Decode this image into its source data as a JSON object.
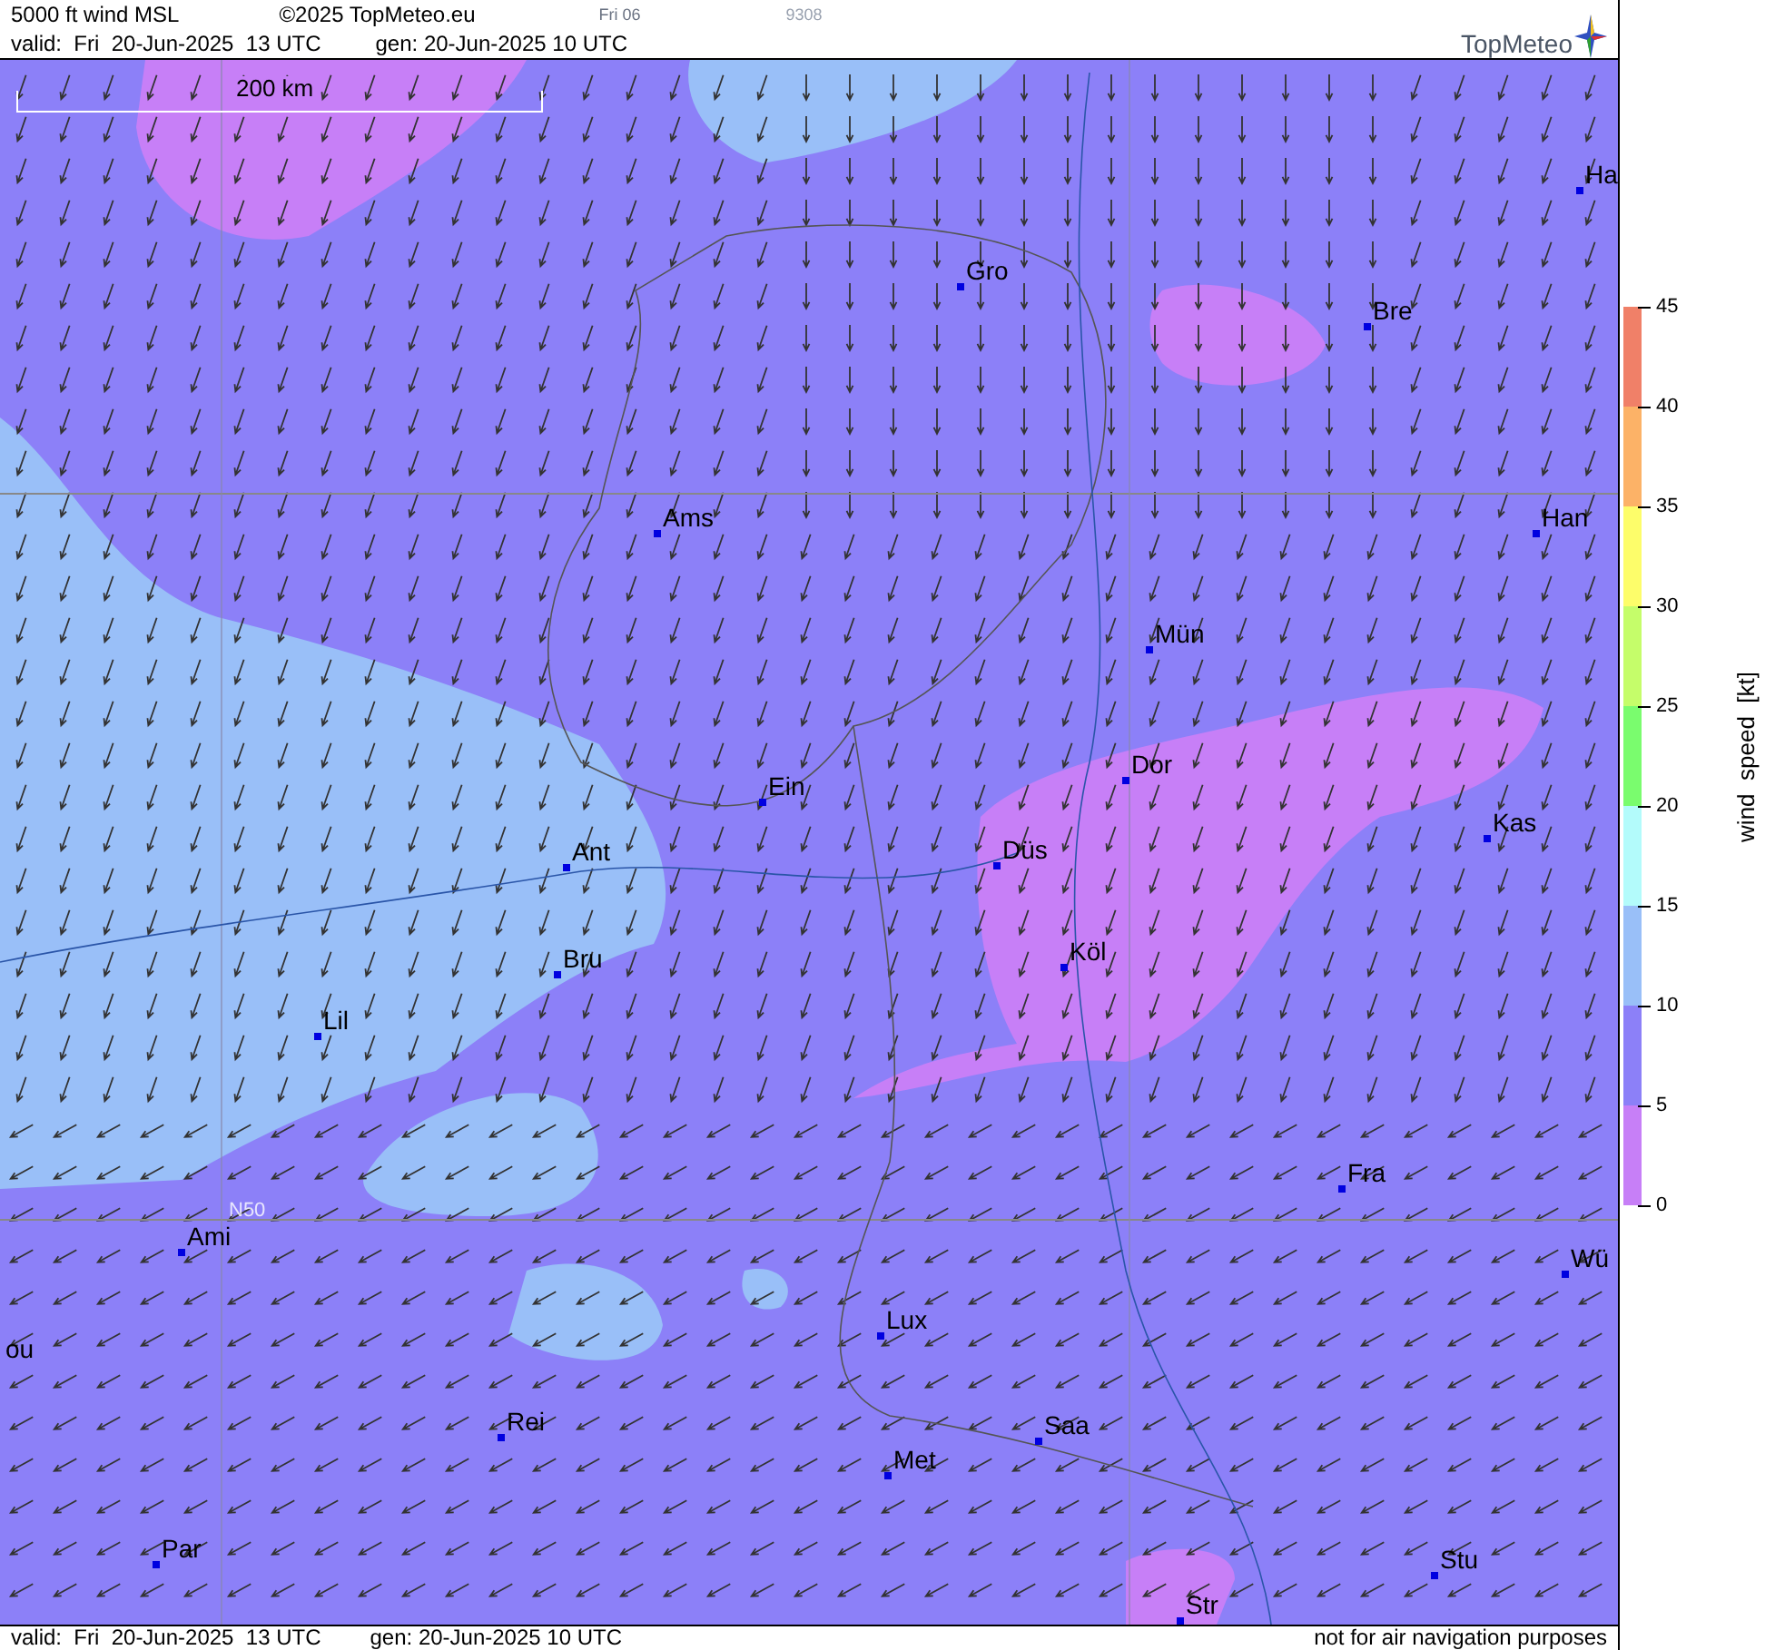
{
  "header": {
    "title": "5000 ft wind MSL",
    "copyright": "©2025 TopMeteo.eu",
    "day": "Fri 06",
    "code": "9308",
    "valid": "valid:  Fri  20-Jun-2025  13 UTC",
    "gen": "gen: 20-Jun-2025 10 UTC",
    "logo": "TopMeteo"
  },
  "map": {
    "scale_bar": "200 km",
    "grid_label": "N50",
    "cities": [
      {
        "name": "Ha"
      },
      {
        "name": "Gro"
      },
      {
        "name": "Bre"
      },
      {
        "name": "Ams"
      },
      {
        "name": "Han"
      },
      {
        "name": "Mün"
      },
      {
        "name": "Dor"
      },
      {
        "name": "Ein"
      },
      {
        "name": "Kas"
      },
      {
        "name": "Düs"
      },
      {
        "name": "Ant"
      },
      {
        "name": "Köl"
      },
      {
        "name": "Bru"
      },
      {
        "name": "Lil"
      },
      {
        "name": "Fra"
      },
      {
        "name": "Ami"
      },
      {
        "name": "Wü"
      },
      {
        "name": "Lux"
      },
      {
        "name": "ou"
      },
      {
        "name": "Rei"
      },
      {
        "name": "Saa"
      },
      {
        "name": "Met"
      },
      {
        "name": "Par"
      },
      {
        "name": "Stu"
      },
      {
        "name": "Str"
      }
    ]
  },
  "legend": {
    "title": "wind  speed  [kt]",
    "ticks": [
      "45",
      "40",
      "35",
      "30",
      "25",
      "20",
      "15",
      "10",
      "5",
      "0"
    ],
    "bands": [
      {
        "color": "#f08068"
      },
      {
        "color": "#fcb267"
      },
      {
        "color": "#fdfd6a"
      },
      {
        "color": "#c5fd6a"
      },
      {
        "color": "#7afc6e"
      },
      {
        "color": "#b3fbfb"
      },
      {
        "color": "#99bff8"
      },
      {
        "color": "#8c80f8"
      },
      {
        "color": "#c77ff7"
      }
    ]
  },
  "footer": {
    "valid": "valid:  Fri  20-Jun-2025  13 UTC",
    "gen": "gen: 20-Jun-2025 10 UTC",
    "disclaimer": "not for air navigation purposes"
  }
}
